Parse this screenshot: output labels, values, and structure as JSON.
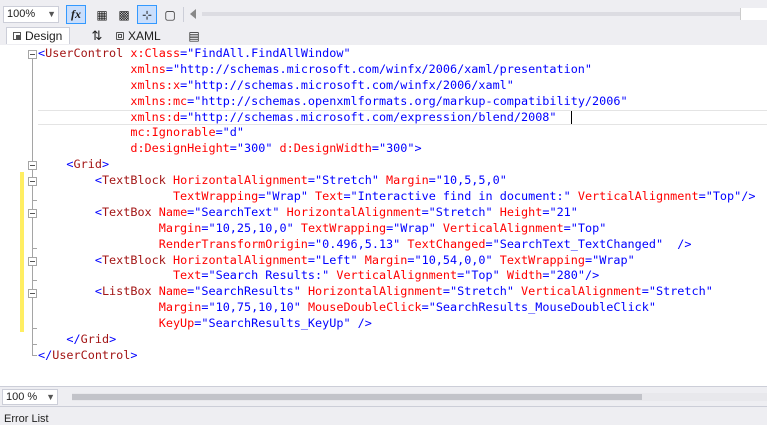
{
  "toolbar": {
    "zoom": "100%",
    "buttons": [
      {
        "name": "formula-icon",
        "glyph": "fx"
      },
      {
        "name": "grid-icon",
        "glyph": "▦"
      },
      {
        "name": "snap-grid-icon",
        "glyph": "▩"
      },
      {
        "name": "snap-lines-icon",
        "glyph": "⊹"
      },
      {
        "name": "annotation-icon",
        "glyph": "▢"
      }
    ]
  },
  "tabs": {
    "design": "Design",
    "swap": "⇅",
    "xaml": "XAML",
    "popup": "▤"
  },
  "code_lines": [
    [
      [
        "t-br",
        "<"
      ],
      [
        "t-el",
        "UserControl"
      ],
      [
        "t-at",
        " x:Class"
      ],
      [
        "t-br",
        "=\""
      ],
      [
        "t-val",
        "FindAll.FindAllWindow"
      ],
      [
        "t-br",
        "\""
      ]
    ],
    [
      [
        "",
        "             "
      ],
      [
        "t-at",
        "xmlns"
      ],
      [
        "t-br",
        "=\""
      ],
      [
        "t-val",
        "http://schemas.microsoft.com/winfx/2006/xaml/presentation"
      ],
      [
        "t-br",
        "\""
      ]
    ],
    [
      [
        "",
        "             "
      ],
      [
        "t-at",
        "xmlns:x"
      ],
      [
        "t-br",
        "=\""
      ],
      [
        "t-val",
        "http://schemas.microsoft.com/winfx/2006/xaml"
      ],
      [
        "t-br",
        "\""
      ]
    ],
    [
      [
        "",
        "             "
      ],
      [
        "t-at",
        "xmlns:mc"
      ],
      [
        "t-br",
        "=\""
      ],
      [
        "t-val",
        "http://schemas.openxmlformats.org/markup-compatibility/2006"
      ],
      [
        "t-br",
        "\""
      ]
    ],
    [
      [
        "",
        "             "
      ],
      [
        "t-at",
        "xmlns:d"
      ],
      [
        "t-br",
        "=\""
      ],
      [
        "t-val",
        "http://schemas.microsoft.com/expression/blend/2008"
      ],
      [
        "t-br",
        "\""
      ]
    ],
    [
      [
        "",
        "             "
      ],
      [
        "t-at",
        "mc:Ignorable"
      ],
      [
        "t-br",
        "=\""
      ],
      [
        "t-val",
        "d"
      ],
      [
        "t-br",
        "\""
      ]
    ],
    [
      [
        "",
        "             "
      ],
      [
        "t-at",
        "d:DesignHeight"
      ],
      [
        "t-br",
        "=\""
      ],
      [
        "t-val",
        "300"
      ],
      [
        "t-br",
        "\""
      ],
      [
        "t-at",
        " d:DesignWidth"
      ],
      [
        "t-br",
        "=\""
      ],
      [
        "t-val",
        "300"
      ],
      [
        "t-br",
        "\">"
      ]
    ],
    [
      [
        "",
        "    "
      ],
      [
        "t-br",
        "<"
      ],
      [
        "t-el",
        "Grid"
      ],
      [
        "t-br",
        ">"
      ]
    ],
    [
      [
        "",
        "        "
      ],
      [
        "t-br",
        "<"
      ],
      [
        "t-el",
        "TextBlock"
      ],
      [
        "t-at",
        " HorizontalAlignment"
      ],
      [
        "t-br",
        "=\""
      ],
      [
        "t-val",
        "Stretch"
      ],
      [
        "t-br",
        "\""
      ],
      [
        "t-at",
        " Margin"
      ],
      [
        "t-br",
        "=\""
      ],
      [
        "t-val",
        "10,5,5,0"
      ],
      [
        "t-br",
        "\""
      ]
    ],
    [
      [
        "",
        "                   "
      ],
      [
        "t-at",
        "TextWrapping"
      ],
      [
        "t-br",
        "=\""
      ],
      [
        "t-val",
        "Wrap"
      ],
      [
        "t-br",
        "\""
      ],
      [
        "t-at",
        " Text"
      ],
      [
        "t-br",
        "=\""
      ],
      [
        "t-val",
        "Interactive find in document:"
      ],
      [
        "t-br",
        "\""
      ],
      [
        "t-at",
        " VerticalAlignment"
      ],
      [
        "t-br",
        "=\""
      ],
      [
        "t-val",
        "Top"
      ],
      [
        "t-br",
        "\"/>"
      ]
    ],
    [
      [
        "",
        "        "
      ],
      [
        "t-br",
        "<"
      ],
      [
        "t-el",
        "TextBox"
      ],
      [
        "t-at",
        " Name"
      ],
      [
        "t-br",
        "=\""
      ],
      [
        "t-val",
        "SearchText"
      ],
      [
        "t-br",
        "\""
      ],
      [
        "t-at",
        " HorizontalAlignment"
      ],
      [
        "t-br",
        "=\""
      ],
      [
        "t-val",
        "Stretch"
      ],
      [
        "t-br",
        "\""
      ],
      [
        "t-at",
        " Height"
      ],
      [
        "t-br",
        "=\""
      ],
      [
        "t-val",
        "21"
      ],
      [
        "t-br",
        "\""
      ]
    ],
    [
      [
        "",
        "                 "
      ],
      [
        "t-at",
        "Margin"
      ],
      [
        "t-br",
        "=\""
      ],
      [
        "t-val",
        "10,25,10,0"
      ],
      [
        "t-br",
        "\""
      ],
      [
        "t-at",
        " TextWrapping"
      ],
      [
        "t-br",
        "=\""
      ],
      [
        "t-val",
        "Wrap"
      ],
      [
        "t-br",
        "\""
      ],
      [
        "t-at",
        " VerticalAlignment"
      ],
      [
        "t-br",
        "=\""
      ],
      [
        "t-val",
        "Top"
      ],
      [
        "t-br",
        "\""
      ]
    ],
    [
      [
        "",
        "                 "
      ],
      [
        "t-at",
        "RenderTransformOrigin"
      ],
      [
        "t-br",
        "=\""
      ],
      [
        "t-val",
        "0.496,5.13"
      ],
      [
        "t-br",
        "\""
      ],
      [
        "t-at",
        " TextChanged"
      ],
      [
        "t-br",
        "=\""
      ],
      [
        "t-val",
        "SearchText_TextChanged"
      ],
      [
        "t-br",
        "\"  />"
      ]
    ],
    [
      [
        "",
        "        "
      ],
      [
        "t-br",
        "<"
      ],
      [
        "t-el",
        "TextBlock"
      ],
      [
        "t-at",
        " HorizontalAlignment"
      ],
      [
        "t-br",
        "=\""
      ],
      [
        "t-val",
        "Left"
      ],
      [
        "t-br",
        "\""
      ],
      [
        "t-at",
        " Margin"
      ],
      [
        "t-br",
        "=\""
      ],
      [
        "t-val",
        "10,54,0,0"
      ],
      [
        "t-br",
        "\""
      ],
      [
        "t-at",
        " TextWrapping"
      ],
      [
        "t-br",
        "=\""
      ],
      [
        "t-val",
        "Wrap"
      ],
      [
        "t-br",
        "\""
      ]
    ],
    [
      [
        "",
        "                   "
      ],
      [
        "t-at",
        "Text"
      ],
      [
        "t-br",
        "=\""
      ],
      [
        "t-val",
        "Search Results:"
      ],
      [
        "t-br",
        "\""
      ],
      [
        "t-at",
        " VerticalAlignment"
      ],
      [
        "t-br",
        "=\""
      ],
      [
        "t-val",
        "Top"
      ],
      [
        "t-br",
        "\""
      ],
      [
        "t-at",
        " Width"
      ],
      [
        "t-br",
        "=\""
      ],
      [
        "t-val",
        "280"
      ],
      [
        "t-br",
        "\"/>"
      ]
    ],
    [
      [
        "",
        "        "
      ],
      [
        "t-br",
        "<"
      ],
      [
        "t-el",
        "ListBox"
      ],
      [
        "t-at",
        " Name"
      ],
      [
        "t-br",
        "=\""
      ],
      [
        "t-val",
        "SearchResults"
      ],
      [
        "t-br",
        "\""
      ],
      [
        "t-at",
        " HorizontalAlignment"
      ],
      [
        "t-br",
        "=\""
      ],
      [
        "t-val",
        "Stretch"
      ],
      [
        "t-br",
        "\""
      ],
      [
        "t-at",
        " VerticalAlignment"
      ],
      [
        "t-br",
        "=\""
      ],
      [
        "t-val",
        "Stretch"
      ],
      [
        "t-br",
        "\""
      ]
    ],
    [
      [
        "",
        "                 "
      ],
      [
        "t-at",
        "Margin"
      ],
      [
        "t-br",
        "=\""
      ],
      [
        "t-val",
        "10,75,10,10"
      ],
      [
        "t-br",
        "\""
      ],
      [
        "t-at",
        " MouseDoubleClick"
      ],
      [
        "t-br",
        "=\""
      ],
      [
        "t-val",
        "SearchResults_MouseDoubleClick"
      ],
      [
        "t-br",
        "\""
      ]
    ],
    [
      [
        "",
        "                 "
      ],
      [
        "t-at",
        "KeyUp"
      ],
      [
        "t-br",
        "=\""
      ],
      [
        "t-val",
        "SearchResults_KeyUp"
      ],
      [
        "t-br",
        "\" />"
      ]
    ],
    [
      [
        "",
        "    "
      ],
      [
        "t-br",
        "</"
      ],
      [
        "t-el",
        "Grid"
      ],
      [
        "t-br",
        ">"
      ]
    ],
    [
      [
        "t-br",
        "</"
      ],
      [
        "t-el",
        "UserControl"
      ],
      [
        "t-br",
        ">"
      ]
    ]
  ],
  "status": {
    "zoom": "100 %",
    "error_list": "Error List"
  }
}
